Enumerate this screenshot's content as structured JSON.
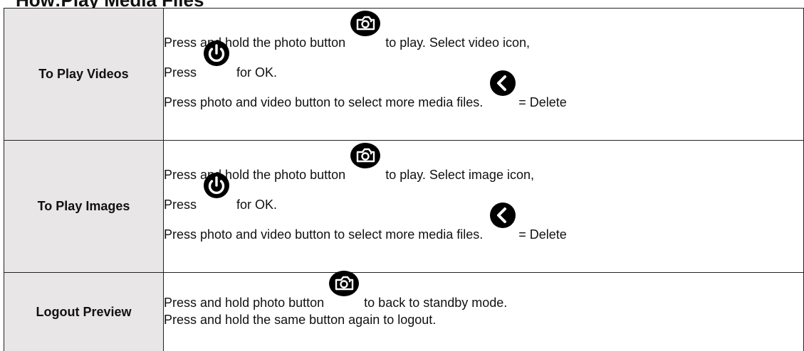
{
  "heading": "How:Play Media Files",
  "rows": [
    {
      "label": "To Play Videos",
      "line1_before": "Press and hold the photo button",
      "line1_after": "to play. Select video icon,",
      "line2_before": "Press",
      "line2_after": "for OK.",
      "line3_before": "Press photo and video button to select more media files.",
      "line3_after": "= Delete"
    },
    {
      "label": "To Play Images",
      "line1_before": "Press and hold the photo button",
      "line1_after": "to play. Select image icon,",
      "line2_before": "Press",
      "line2_after": "for OK.",
      "line3_before": "Press photo and video button to select more media files.",
      "line3_after": "= Delete"
    },
    {
      "label": "Logout Preview",
      "line1_before": "Press and hold photo button",
      "line1_after": "to back to standby mode.",
      "line2_text": "Press and hold the same button again to logout."
    }
  ],
  "icons": {
    "photo": "camera-icon",
    "ok": "power-icon",
    "delete": "back-chevron-icon",
    "color": "#000000"
  }
}
